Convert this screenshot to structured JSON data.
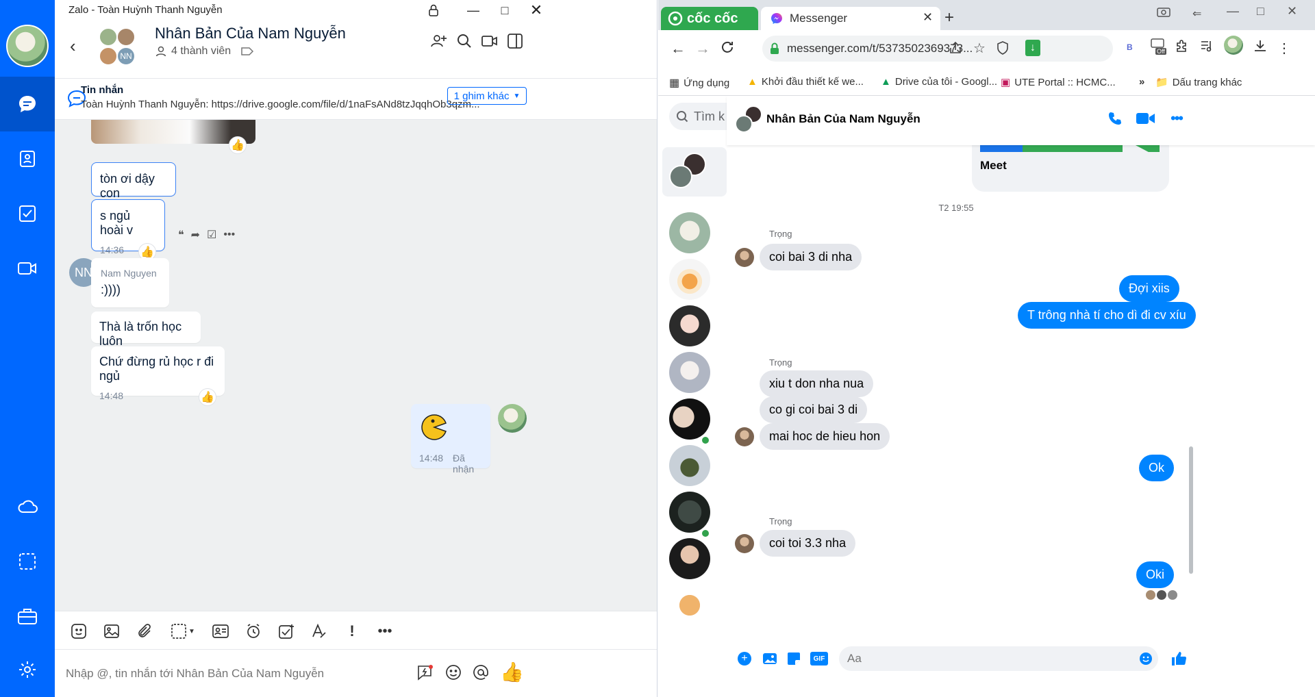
{
  "zalo": {
    "window_title": "Zalo - Toàn Huỳnh Thanh Nguyễn",
    "header": {
      "name": "Nhân Bản Của Nam Nguyễn",
      "members": "4 thành viên",
      "avatar_initials": "NN"
    },
    "pinned": {
      "label": "Tin nhắn",
      "text": "Toàn Huỳnh Thanh Nguyễn: https://drive.google.com/file/d/1naFsANd8tzJqqhOb3qzm...",
      "more": "1 ghim khác"
    },
    "messages": [
      {
        "text": "tòn ơi dậy con"
      },
      {
        "text": "s ngủ hoài v",
        "time": "14:36"
      },
      {
        "sender": "Nam Nguyen",
        "initials": "NN",
        "text": ":))))"
      },
      {
        "text": "Thà là trốn học luôn"
      },
      {
        "text": "Chứ đừng rủ học r đi ngủ",
        "time": "14:48"
      },
      {
        "time": "14:48",
        "status": "Đã nhận"
      }
    ],
    "input_placeholder": "Nhập @, tin nhắn tới Nhân Bản Của Nam Nguyễn"
  },
  "browser": {
    "brand": "cốc cốc",
    "tab_title": "Messenger",
    "url": "messenger.com/t/5373502369373...",
    "extension_off": "Off",
    "extension_b": "B",
    "bookmarks": [
      "Ứng dụng",
      "Khởi đầu thiết kế we...",
      "Drive của tôi - Googl...",
      "UTE Portal :: HCMC..."
    ],
    "bookmarks_more": "»",
    "bookmarks_folder": "Dấu trang khác"
  },
  "messenger": {
    "search_placeholder": "Tìm k",
    "title": "Nhân Bản Của Nam Nguyễn",
    "meet_label": "Meet",
    "time_divider": "T2 19:55",
    "messages": [
      {
        "sender": "Trọng",
        "text": "coi bai 3 di nha"
      },
      {
        "text": "Đợi xiis"
      },
      {
        "text": "T trông nhà tí cho dì đi cv xíu"
      },
      {
        "sender": "Trọng",
        "text": "xiu t don nha nua"
      },
      {
        "text": "co gi coi bai 3 di"
      },
      {
        "text": "mai hoc de hieu hon"
      },
      {
        "text": "Ok"
      },
      {
        "sender": "Trọng",
        "text": "coi toi 3.3 nha"
      },
      {
        "text": "Oki"
      }
    ],
    "composer_placeholder": "Aa",
    "gif_label": "GIF"
  },
  "colors": {
    "zalo_blue": "#0068ff",
    "messenger_blue": "#0084ff",
    "coccoc_green": "#2fa84f"
  }
}
